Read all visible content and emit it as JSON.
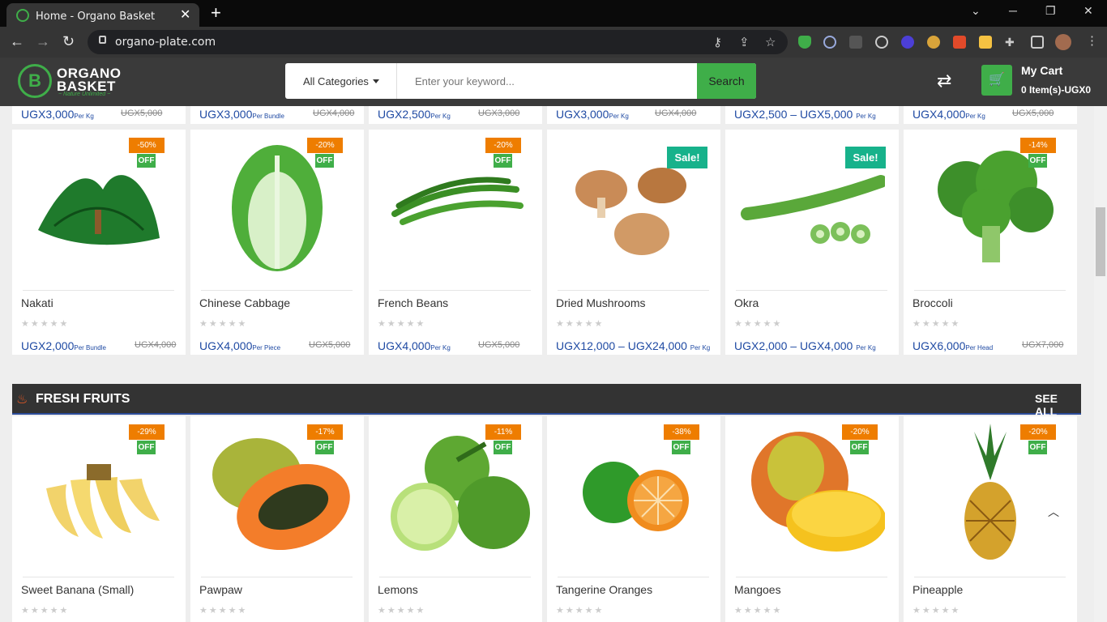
{
  "browser": {
    "tab_title": "Home - Organo Basket",
    "tab_close": "✕",
    "new_tab": "+",
    "url": "organo-plate.com"
  },
  "site": {
    "logo_line1": "ORGANO",
    "logo_line2": "BASKET",
    "logo_tagline": "~ Nature Unlimited ~",
    "logo_mark": "B",
    "category": "All Categories",
    "search_placeholder": "Enter your keyword...",
    "search_button": "Search",
    "cart_title": "My Cart",
    "cart_summary": "0 Item(s)-UGX0"
  },
  "top_row": [
    {
      "price": "UGX3,000",
      "unit": "Per Kg",
      "old": "UGX5,000"
    },
    {
      "price": "UGX3,000",
      "unit": "Per Bundle",
      "old": "UGX4,000"
    },
    {
      "price": "UGX2,500",
      "unit": "Per Kg",
      "old": "UGX3,000"
    },
    {
      "price": "UGX3,000",
      "unit": "Per Kg",
      "old": "UGX4,000"
    },
    {
      "price": "UGX2,500 – UGX5,000",
      "unit": "Per Kg",
      "old": ""
    },
    {
      "price": "UGX4,000",
      "unit": "Per Kg",
      "old": "UGX5,000"
    }
  ],
  "vegetables": [
    {
      "name": "Nakati",
      "discount": "-50%",
      "off": "OFF",
      "sale": "",
      "price": "UGX2,000",
      "unit": "Per Bundle",
      "old": "UGX4,000",
      "stars": "★★★★★"
    },
    {
      "name": "Chinese Cabbage",
      "discount": "-20%",
      "off": "OFF",
      "sale": "",
      "price": "UGX4,000",
      "unit": "Per Piece",
      "old": "UGX5,000",
      "stars": "★★★★★"
    },
    {
      "name": "French Beans",
      "discount": "-20%",
      "off": "OFF",
      "sale": "",
      "price": "UGX4,000",
      "unit": "Per Kg",
      "old": "UGX5,000",
      "stars": "★★★★★"
    },
    {
      "name": "Dried Mushrooms",
      "discount": "",
      "off": "",
      "sale": "Sale!",
      "price": "UGX12,000 – UGX24,000",
      "unit": "Per Kg",
      "old": "",
      "stars": "★★★★★"
    },
    {
      "name": "Okra",
      "discount": "",
      "off": "",
      "sale": "Sale!",
      "price": "UGX2,000 – UGX4,000",
      "unit": "Per Kg",
      "old": "",
      "stars": "★★★★★"
    },
    {
      "name": "Broccoli",
      "discount": "-14%",
      "off": "OFF",
      "sale": "",
      "price": "UGX6,000",
      "unit": "Per Head",
      "old": "UGX7,000",
      "stars": "★★★★★"
    }
  ],
  "fruits_section": {
    "title": "FRESH FRUITS",
    "see_all": "SEE ALL"
  },
  "fruits": [
    {
      "name": "Sweet Banana (Small)",
      "discount": "-29%",
      "off": "OFF",
      "stars": "★★★★★"
    },
    {
      "name": "Pawpaw",
      "discount": "-17%",
      "off": "OFF",
      "stars": "★★★★★"
    },
    {
      "name": "Lemons",
      "discount": "-11%",
      "off": "OFF",
      "stars": "★★★★★"
    },
    {
      "name": "Tangerine Oranges",
      "discount": "-38%",
      "off": "OFF",
      "stars": "★★★★★"
    },
    {
      "name": "Mangoes",
      "discount": "-20%",
      "off": "OFF",
      "stars": "★★★★★"
    },
    {
      "name": "Pineapple",
      "discount": "-20%",
      "off": "OFF",
      "stars": "★★★★★"
    }
  ],
  "colors": {
    "brand_green": "#3fae49",
    "price_blue": "#1f4aa3",
    "badge_orange": "#ee7d00",
    "sale_teal": "#17b28b"
  },
  "icons": [
    "back-icon",
    "forward-icon",
    "reload-icon",
    "lock-icon",
    "key-icon",
    "share-icon",
    "star-icon",
    "shuffle-icon",
    "cart-icon",
    "fire-icon",
    "chevron-up-icon"
  ]
}
